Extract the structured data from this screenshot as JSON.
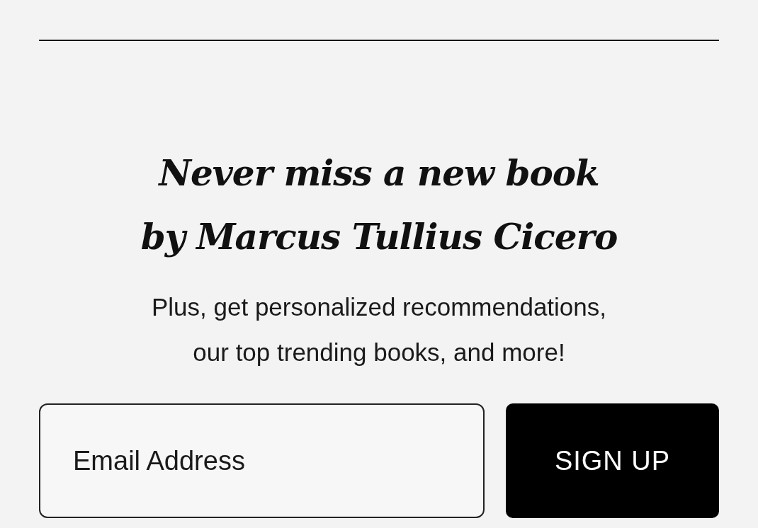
{
  "heading": {
    "lines": [
      "Never miss a new book",
      "by Marcus Tullius Cicero"
    ]
  },
  "subtext": {
    "lines": [
      "Plus, get personalized recommendations,",
      "our top trending books, and more!"
    ]
  },
  "email": {
    "placeholder": "Email Address"
  },
  "button": {
    "label": "SIGN UP"
  }
}
